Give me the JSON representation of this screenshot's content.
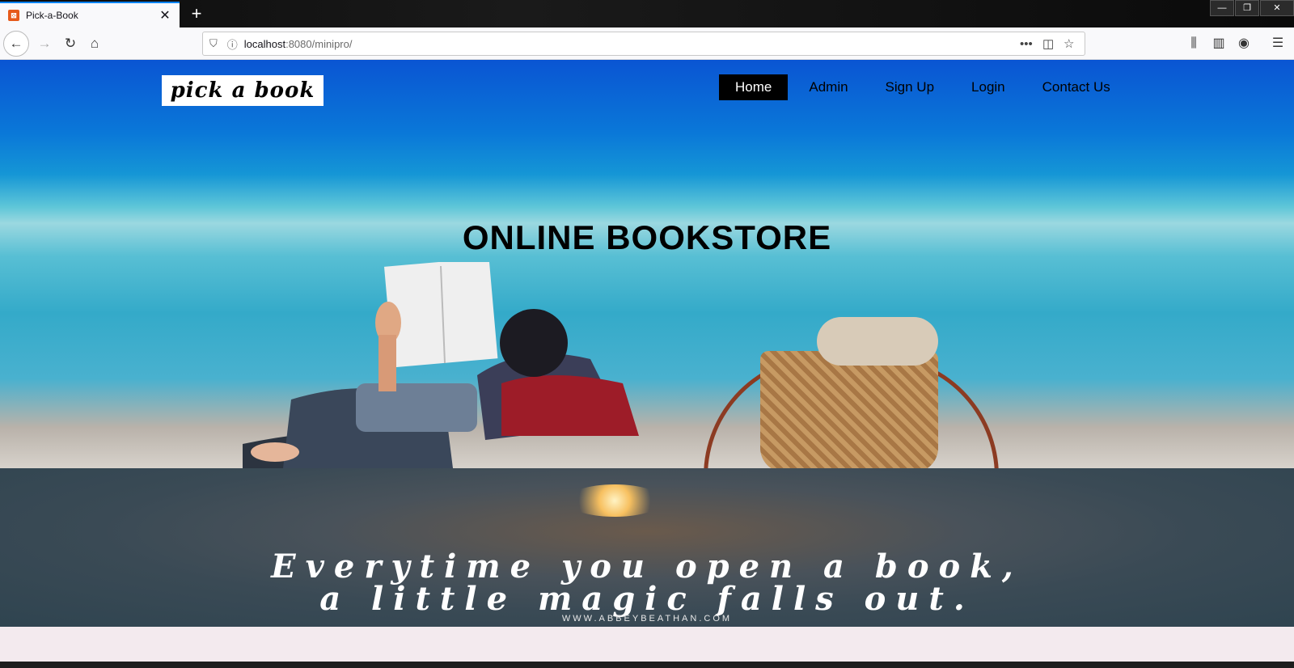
{
  "browser": {
    "tab_title": "Pick-a-Book",
    "url_host": "localhost",
    "url_rest": ":8080/minipro/"
  },
  "site": {
    "logo_text": "pick a book",
    "nav": [
      {
        "label": "Home",
        "active": true
      },
      {
        "label": "Admin",
        "active": false
      },
      {
        "label": "Sign Up",
        "active": false
      },
      {
        "label": "Login",
        "active": false
      },
      {
        "label": "Contact Us",
        "active": false
      }
    ],
    "hero_title": "ONLINE BOOKSTORE",
    "quote_line1": "Everytime you open a book,",
    "quote_line2": "a little magic falls out.",
    "quote_source": "WWW.ABBEYBEATHAN.COM"
  },
  "icons": {
    "back": "back-arrow-icon",
    "forward": "forward-arrow-icon",
    "reload": "reload-icon",
    "home": "home-icon",
    "shield": "tracking-shield-icon",
    "info": "info-icon",
    "more": "more-dots-icon",
    "pocket": "pocket-icon",
    "bookmark": "star-icon",
    "library": "library-icon",
    "sidebar": "sidebar-icon",
    "account": "account-icon",
    "menu": "hamburger-menu-icon"
  }
}
